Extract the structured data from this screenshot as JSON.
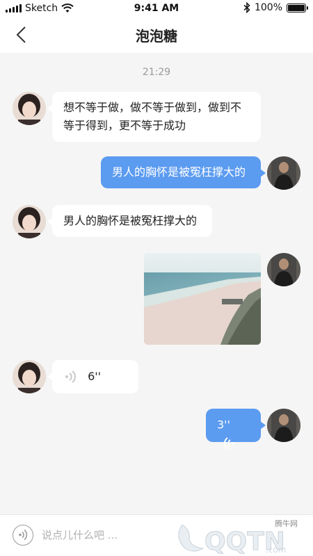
{
  "status_bar": {
    "carrier": "Sketch",
    "time": "9:41 AM",
    "battery": "100%"
  },
  "nav": {
    "title": "泡泡糖",
    "back_icon": "chevron-left-icon"
  },
  "chat": {
    "timestamp": "21:29",
    "messages": [
      {
        "side": "left",
        "type": "text",
        "text_line1": "想不等于做，做不等于做到，做到不",
        "text_line2": "等于得到，更不等于成功"
      },
      {
        "side": "right",
        "type": "text",
        "text": "男人的胸怀是被冤枉撑大的"
      },
      {
        "side": "left",
        "type": "text",
        "text": "男人的胸怀是被冤枉撑大的"
      },
      {
        "side": "right",
        "type": "image",
        "image_desc": "beach-photo"
      },
      {
        "side": "left",
        "type": "voice",
        "duration": "6''"
      },
      {
        "side": "right",
        "type": "voice",
        "duration": "3''"
      }
    ]
  },
  "input_bar": {
    "placeholder": "说点儿什么吧 ...",
    "voice_icon": "voice-toggle-icon"
  },
  "watermark": {
    "label": "腾牛网",
    "logo_text": "QQTN.com"
  },
  "colors": {
    "bubble_right": "#5b9bf0",
    "bubble_left": "#ffffff",
    "background": "#f5f5f5"
  }
}
